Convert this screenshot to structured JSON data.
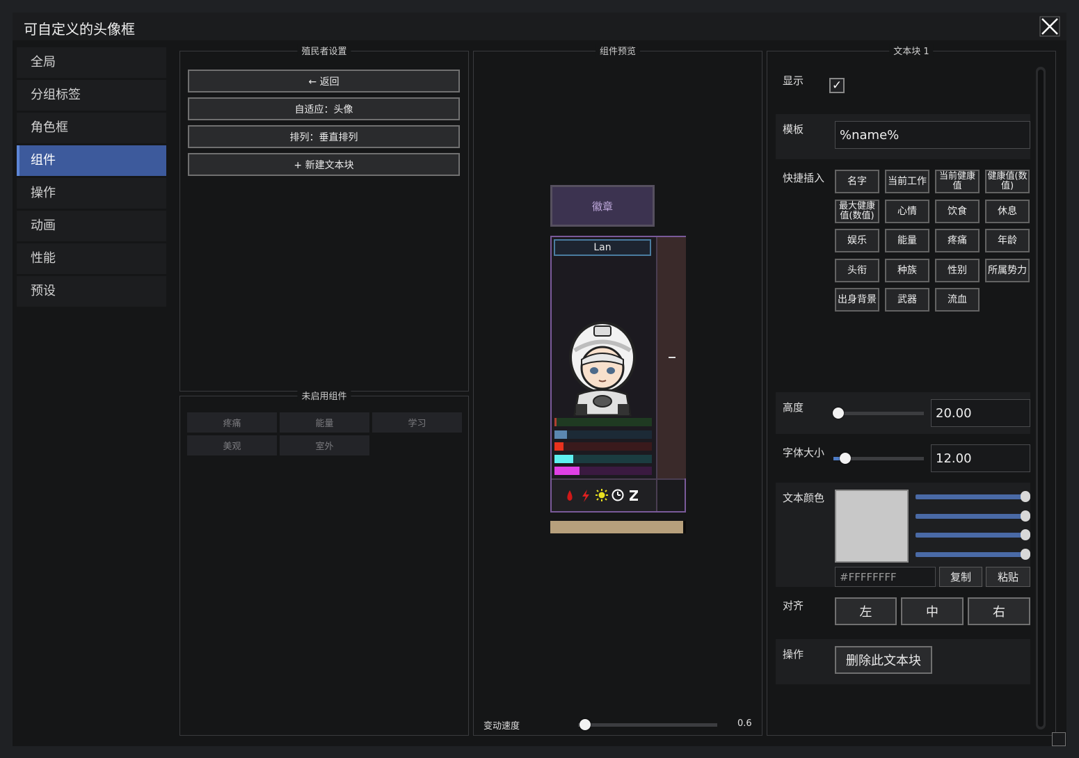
{
  "window": {
    "title": "可自定义的头像框"
  },
  "nav": {
    "items": [
      {
        "label": "全局"
      },
      {
        "label": "分组标签"
      },
      {
        "label": "角色框"
      },
      {
        "label": "组件",
        "active": true
      },
      {
        "label": "操作"
      },
      {
        "label": "动画"
      },
      {
        "label": "性能"
      },
      {
        "label": "预设"
      }
    ]
  },
  "colonist_settings": {
    "title": "殖民者设置",
    "back_button": "← 返回",
    "fit_button": "自适应：头像",
    "arrange_button": "排列：垂直排列",
    "new_textblock_button": "+ 新建文本块"
  },
  "disabled_components": {
    "title": "未启用组件",
    "items": [
      "疼痛",
      "能量",
      "学习",
      "美观",
      "室外"
    ]
  },
  "preview": {
    "title": "组件预览",
    "badge_label": "徽章",
    "name_label": "Lan",
    "bars": [
      {
        "color": "#b04030",
        "bg": "#1f3a22",
        "fill": 0.02
      },
      {
        "color": "#5b87b0",
        "bg": "#1c2a36",
        "fill": 0.13
      },
      {
        "color": "#e8321e",
        "bg": "#3a1a1c",
        "fill": 0.09
      },
      {
        "color": "#5ef0f0",
        "bg": "#1b3c40",
        "fill": 0.19
      },
      {
        "color": "#e040e6",
        "bg": "#3a1a40",
        "fill": 0.26
      }
    ],
    "status_icons": [
      "blood-drop-icon",
      "lightning-icon",
      "sun-icon",
      "clock-icon",
      "sleep-icon"
    ],
    "bottom_bar_fill": 0.98,
    "speed_label": "变动速度",
    "speed_value": "0.6"
  },
  "textblock": {
    "title": "文本块 1",
    "show_label": "显示",
    "show_checked": "✓",
    "template_label": "模板",
    "template_value": "%name%",
    "quick_insert_label": "快捷插入",
    "quick_insert": [
      [
        "名字",
        "当前工作",
        "当前健康值",
        "健康值(数值)"
      ],
      [
        "最大健康值(数值)",
        "心情",
        "饮食",
        "休息"
      ],
      [
        "娱乐",
        "能量",
        "疼痛",
        "年龄"
      ],
      [
        "头衔",
        "种族",
        "性别",
        "所属势力"
      ],
      [
        "出身背景",
        "武器",
        "流血"
      ]
    ],
    "height_label": "高度",
    "height_value": "20.00",
    "font_size_label": "字体大小",
    "font_size_value": "12.00",
    "color_label": "文本颜色",
    "color_hex": "#FFFFFFFF",
    "copy_button": "复制",
    "paste_button": "粘贴",
    "align_label": "对齐",
    "align_left": "左",
    "align_center": "中",
    "align_right": "右",
    "action_label": "操作",
    "delete_button": "删除此文本块"
  }
}
